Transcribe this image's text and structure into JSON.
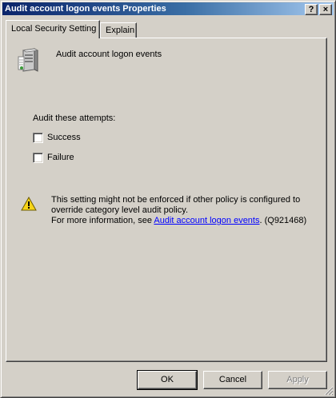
{
  "window": {
    "title": "Audit account logon events Properties",
    "help_glyph": "?",
    "close_glyph": "×"
  },
  "tabs": [
    {
      "label": "Local Security Setting",
      "active": true
    },
    {
      "label": "Explain",
      "active": false
    }
  ],
  "policy": {
    "icon": "server-policy-icon",
    "name": "Audit account logon events"
  },
  "audit": {
    "group_label": "Audit these attempts:",
    "options": [
      {
        "label": "Success",
        "checked": false
      },
      {
        "label": "Failure",
        "checked": false
      }
    ]
  },
  "warning": {
    "icon": "warning-icon",
    "line1": "This setting might not be enforced if other policy is configured to",
    "line2": "override category level audit policy.",
    "line3_prefix": "For more information, see ",
    "link_text": "Audit account logon events",
    "line3_suffix": ". (Q921468)"
  },
  "buttons": {
    "ok": "OK",
    "cancel": "Cancel",
    "apply": "Apply"
  },
  "colors": {
    "titlebar_start": "#0a246a",
    "titlebar_end": "#a6caf0",
    "face": "#d4d0c8",
    "link": "#0000ff"
  }
}
